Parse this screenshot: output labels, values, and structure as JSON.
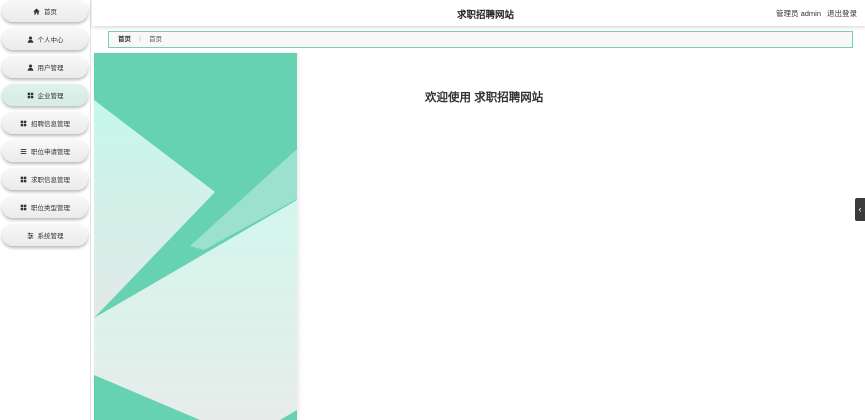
{
  "app": {
    "title": "求职招聘网站"
  },
  "header": {
    "user_label": "管理员 admin",
    "logout_label": "退出登录"
  },
  "sidebar": {
    "active_index": 3,
    "items": [
      {
        "label": "首页",
        "icon": "home-icon"
      },
      {
        "label": "个人中心",
        "icon": "user-icon"
      },
      {
        "label": "用户管理",
        "icon": "user-icon"
      },
      {
        "label": "企业管理",
        "icon": "grid-icon"
      },
      {
        "label": "招聘信息管理",
        "icon": "grid-icon"
      },
      {
        "label": "职位申请管理",
        "icon": "list-icon"
      },
      {
        "label": "求职信息管理",
        "icon": "grid-icon"
      },
      {
        "label": "职位类型管理",
        "icon": "grid-icon"
      },
      {
        "label": "系统管理",
        "icon": "sliders-icon"
      }
    ]
  },
  "breadcrumb": {
    "items": [
      "首页",
      "首页"
    ],
    "separator": "⋮"
  },
  "main": {
    "welcome": "欢迎使用 求职招聘网站"
  },
  "side_tab": {
    "icon": "chevron-left-icon",
    "glyph": "‹"
  },
  "colors": {
    "brand": "#66d2b2",
    "active-bg": "#d6ece5",
    "crumb-border": "#79cfb4",
    "side-tab-bg": "#3b3b3b"
  }
}
